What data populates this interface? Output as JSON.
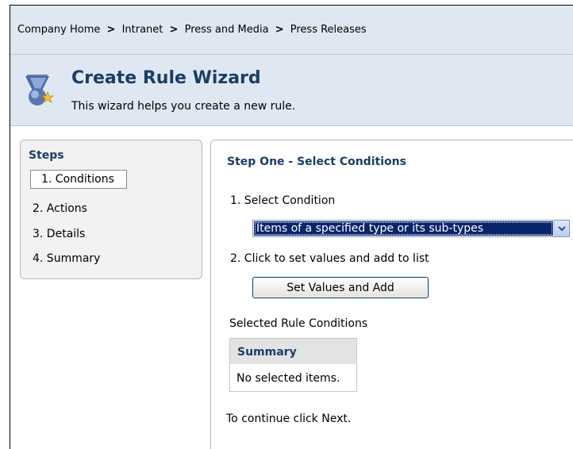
{
  "breadcrumb": {
    "items": [
      "Company Home",
      "Intranet",
      "Press and Media",
      "Press Releases"
    ],
    "separator": ">"
  },
  "wizard": {
    "icon": "rule-wizard-icon",
    "title": "Create Rule Wizard",
    "subtitle": "This wizard helps you create a new rule."
  },
  "steps": {
    "title": "Steps",
    "items": [
      "1. Conditions",
      "2. Actions",
      "3. Details",
      "4. Summary"
    ],
    "active_index": 0
  },
  "main": {
    "heading": "Step One - Select Conditions",
    "select_condition_label": "1.  Select Condition",
    "selected_condition": "Items of a specified type or its sub-types",
    "click_to_set_label": "2.  Click to set values and add to list",
    "set_values_button": "Set Values and Add",
    "selected_conditions_label": "Selected Rule Conditions",
    "summary_header": "Summary",
    "summary_empty": "No selected items.",
    "continue_text": "To continue click Next."
  },
  "colors": {
    "header_bg": "#dfe8f2",
    "heading_blue": "#1c3d68",
    "selection_blue": "#0a246a"
  }
}
